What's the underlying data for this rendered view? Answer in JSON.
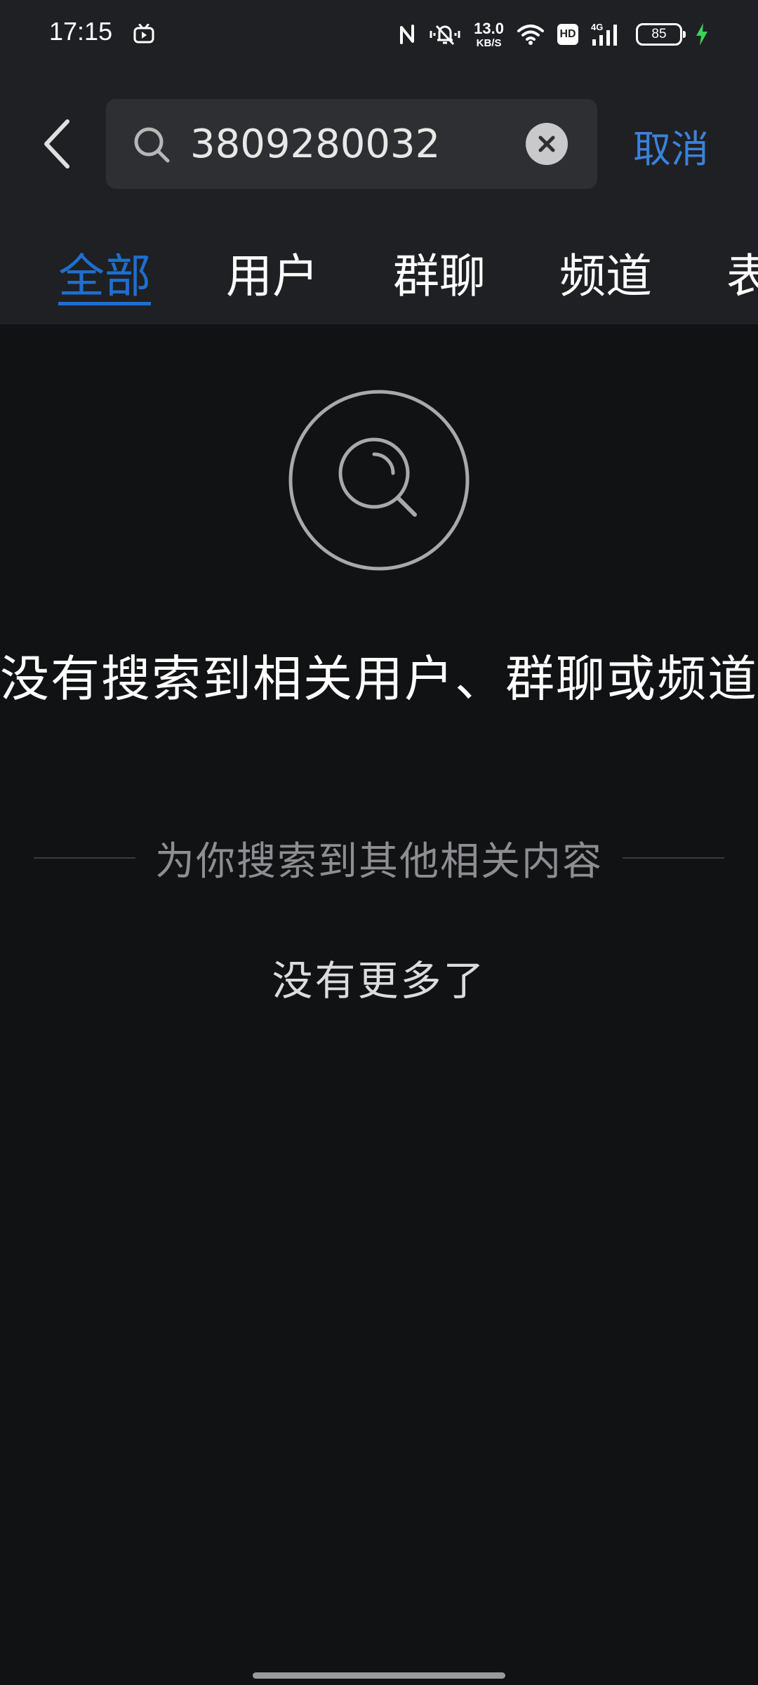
{
  "status_bar": {
    "time": "17:15",
    "net_speed_value": "13.0",
    "net_speed_unit": "KB/S",
    "hd_label": "HD",
    "network_label": "4G",
    "battery_level": "85",
    "icons": [
      "tv-app-icon",
      "nfc-icon",
      "mute-vibrate-icon",
      "wifi-icon",
      "signal-icon",
      "charging-icon"
    ]
  },
  "search": {
    "query": "3809280032",
    "placeholder": "",
    "cancel_label": "取消"
  },
  "tabs": [
    {
      "label": "全部",
      "active": true
    },
    {
      "label": "用户",
      "active": false
    },
    {
      "label": "群聊",
      "active": false
    },
    {
      "label": "频道",
      "active": false
    },
    {
      "label": "表",
      "active": false
    }
  ],
  "empty_state": {
    "title": "没有搜索到相关用户、群聊或频道",
    "related_divider": "为你搜索到其他相关内容",
    "no_more": "没有更多了"
  },
  "colors": {
    "accent": "#1e6fd0",
    "cancel": "#3a82dc",
    "background": "#111214",
    "header_background": "#1f2023",
    "charging": "#3dd05a"
  }
}
